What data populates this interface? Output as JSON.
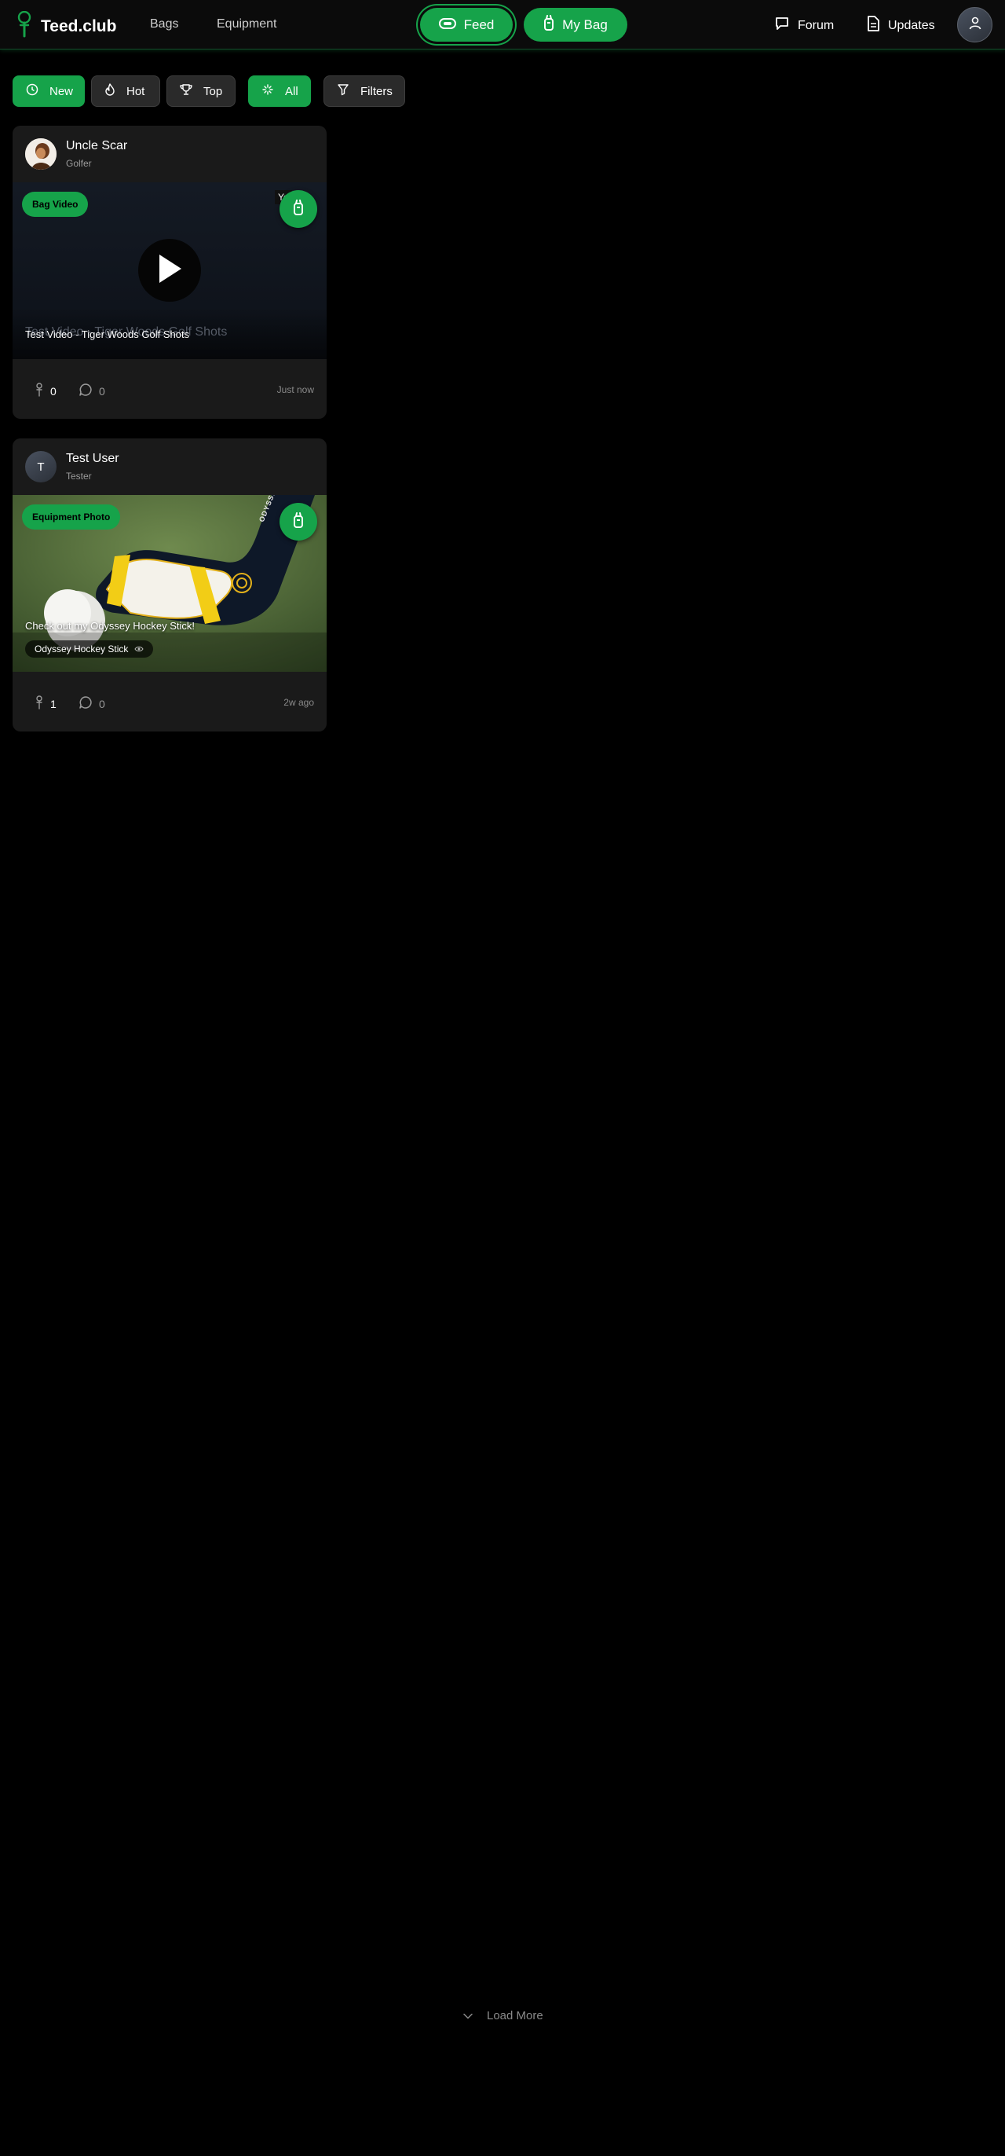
{
  "header": {
    "logo_text": "Teed.club",
    "nav": {
      "bags": "Bags",
      "equipment": "Equipment"
    },
    "feed_label": "Feed",
    "mybag_label": "My Bag",
    "forum_label": "Forum",
    "updates_label": "Updates"
  },
  "filters": {
    "sort": [
      {
        "label": "New"
      },
      {
        "label": "Hot"
      },
      {
        "label": "Top"
      }
    ],
    "all_label": "All",
    "filters_label": "Filters"
  },
  "posts": [
    {
      "user_name": "Uncle Scar",
      "user_role": "Golfer",
      "badge": "Bag Video",
      "corner_tag": "Yo",
      "caption_ghost": "Test Video - Tiger Woods Golf Shots",
      "caption": "Test Video - Tiger Woods Golf Shots",
      "likes": "0",
      "comments": "0",
      "time": "Just now"
    },
    {
      "user_name": "Test User",
      "user_initial": "T",
      "user_role": "Tester",
      "badge": "Equipment Photo",
      "photo_brand": "ODYSSEY",
      "caption": "Check out my Odyssey Hockey Stick!",
      "tag": "Odyssey Hockey Stick",
      "likes": "1",
      "comments": "0",
      "time": "2w ago"
    }
  ],
  "load_more_label": "Load More",
  "colors": {
    "accent": "#16a34a",
    "background": "#000000",
    "card": "#1a1a1a"
  }
}
